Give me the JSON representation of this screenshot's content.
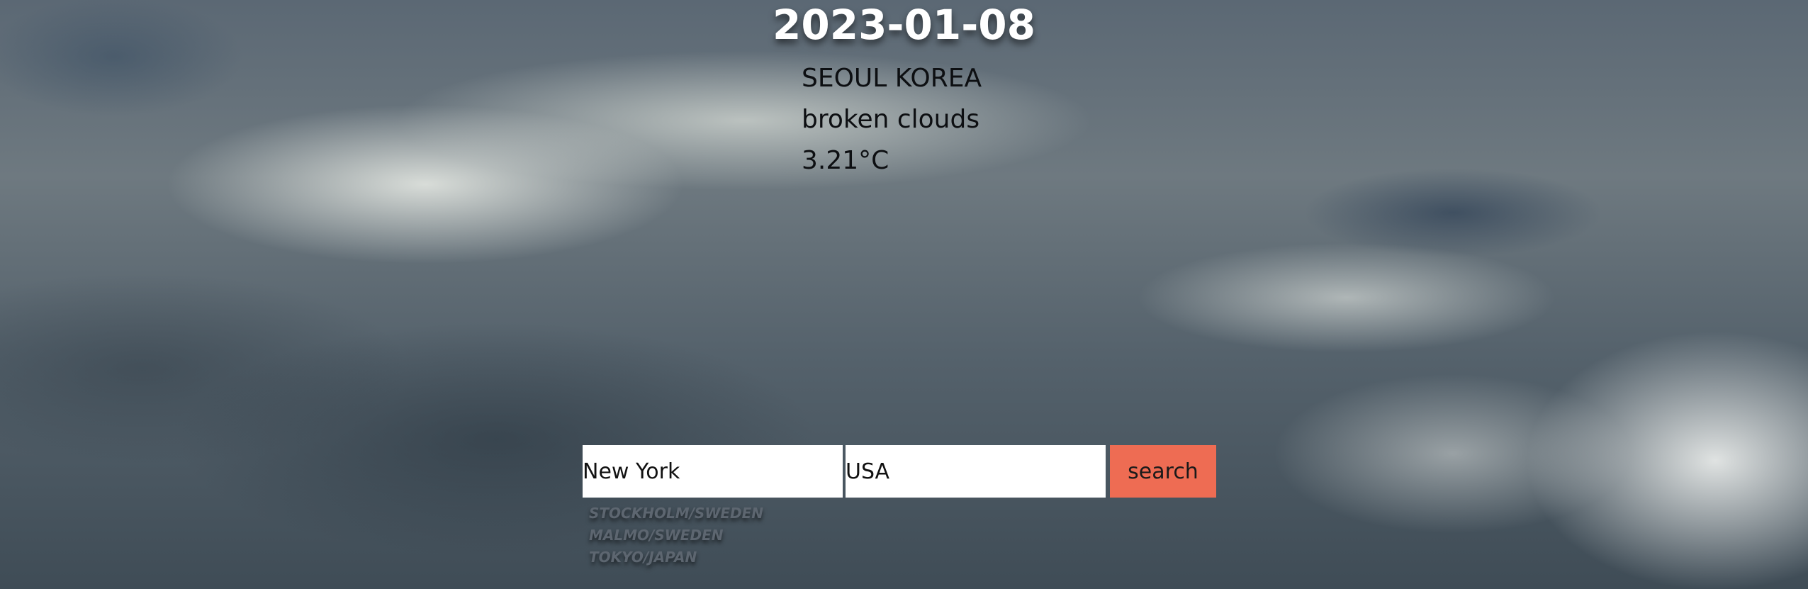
{
  "date": "2023-01-08",
  "weather": {
    "location": "SEOUL KOREA",
    "description": "broken clouds",
    "temperature": "3.21°C"
  },
  "search": {
    "city_value": "New York",
    "country_value": "USA",
    "button_label": "search"
  },
  "suggestions": [
    "STOCKHOLM/SWEDEN",
    "MALMO/SWEDEN",
    "TOKYO/JAPAN"
  ],
  "colors": {
    "button": "#ee6c53",
    "date_text": "#ffffff"
  }
}
